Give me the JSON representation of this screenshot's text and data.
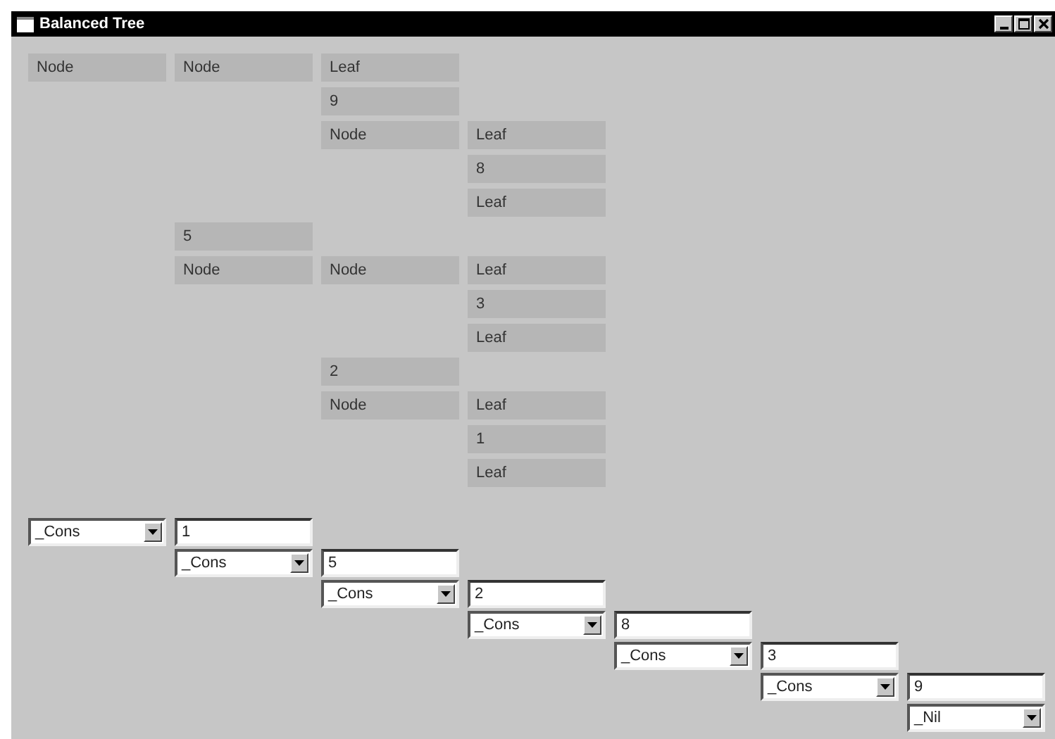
{
  "window": {
    "title": "Balanced Tree"
  },
  "tree": {
    "kind": "node",
    "label": "Node",
    "left": {
      "kind": "node",
      "label": "Node",
      "left": {
        "kind": "leaf",
        "label": "Leaf"
      },
      "value": "9",
      "right": {
        "kind": "node",
        "label": "Node",
        "left": {
          "kind": "leaf",
          "label": "Leaf"
        },
        "value": "8",
        "right": {
          "kind": "leaf",
          "label": "Leaf"
        }
      }
    },
    "value": "5",
    "right": {
      "kind": "node",
      "label": "Node",
      "left": {
        "kind": "node",
        "label": "Node",
        "left": {
          "kind": "leaf",
          "label": "Leaf"
        },
        "value": "3",
        "right": {
          "kind": "leaf",
          "label": "Leaf"
        }
      },
      "value": "2",
      "right": {
        "kind": "node",
        "label": "Node",
        "left": {
          "kind": "leaf",
          "label": "Leaf"
        },
        "value": "1",
        "right": {
          "kind": "leaf",
          "label": "Leaf"
        }
      }
    }
  },
  "list": [
    {
      "constructor": "_Cons",
      "value": "1"
    },
    {
      "constructor": "_Cons",
      "value": "5"
    },
    {
      "constructor": "_Cons",
      "value": "2"
    },
    {
      "constructor": "_Cons",
      "value": "8"
    },
    {
      "constructor": "_Cons",
      "value": "3"
    },
    {
      "constructor": "_Cons",
      "value": "9"
    },
    {
      "constructor": "_Nil"
    }
  ]
}
